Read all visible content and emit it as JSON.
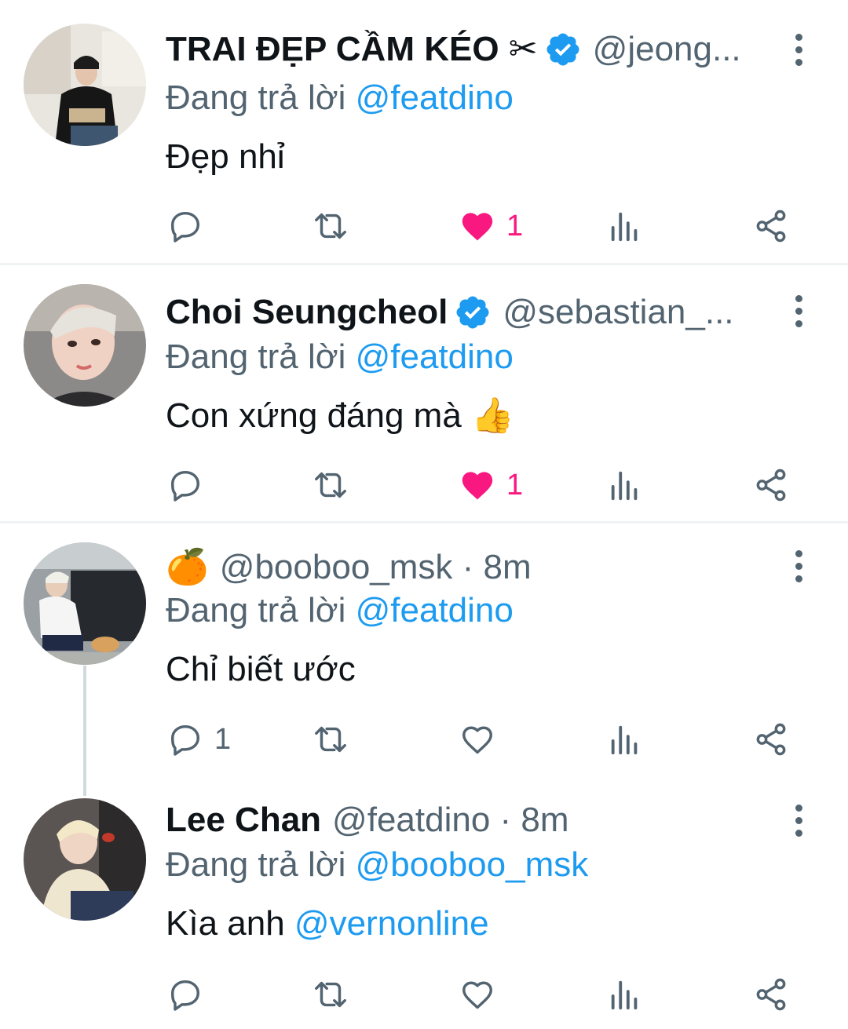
{
  "colors": {
    "accent": "#1d9bf0",
    "muted": "#536471",
    "like": "#f91880",
    "verified": "#1d9bf0"
  },
  "tweets": [
    {
      "name": "TRAI ĐẸP CẦM KÉO ✂",
      "verified": true,
      "handle": "@jeong...",
      "reply_prefix": "Đang trả lời",
      "reply_to": "@featdino",
      "text": "Đẹp nhỉ",
      "counts": {
        "reply": "",
        "retweet": "",
        "like": "1"
      },
      "liked": true
    },
    {
      "name": "Choi Seungcheol",
      "verified": true,
      "handle": "@sebastian_...",
      "reply_prefix": "Đang trả lời",
      "reply_to": "@featdino",
      "text": "Con xứng đáng mà 👍",
      "counts": {
        "reply": "",
        "retweet": "",
        "like": "1"
      },
      "liked": true
    },
    {
      "name": "🍊",
      "verified": false,
      "handle": "@booboo_msk · 8m",
      "reply_prefix": "Đang trả lời",
      "reply_to": "@featdino",
      "text": "Chỉ biết ước",
      "counts": {
        "reply": "1",
        "retweet": "",
        "like": ""
      },
      "liked": false
    },
    {
      "name": "Lee Chan",
      "verified": false,
      "handle": "@featdino · 8m",
      "reply_prefix": "Đang trả lời",
      "reply_to": "@booboo_msk",
      "text": "Kìa anh",
      "text_mention": "@vernonline",
      "counts": {
        "reply": "",
        "retweet": "",
        "like": ""
      },
      "liked": false
    }
  ],
  "icons": [
    "reply-icon",
    "retweet-icon",
    "like-icon",
    "views-icon",
    "share-icon",
    "more-icon",
    "verified-badge-icon"
  ]
}
